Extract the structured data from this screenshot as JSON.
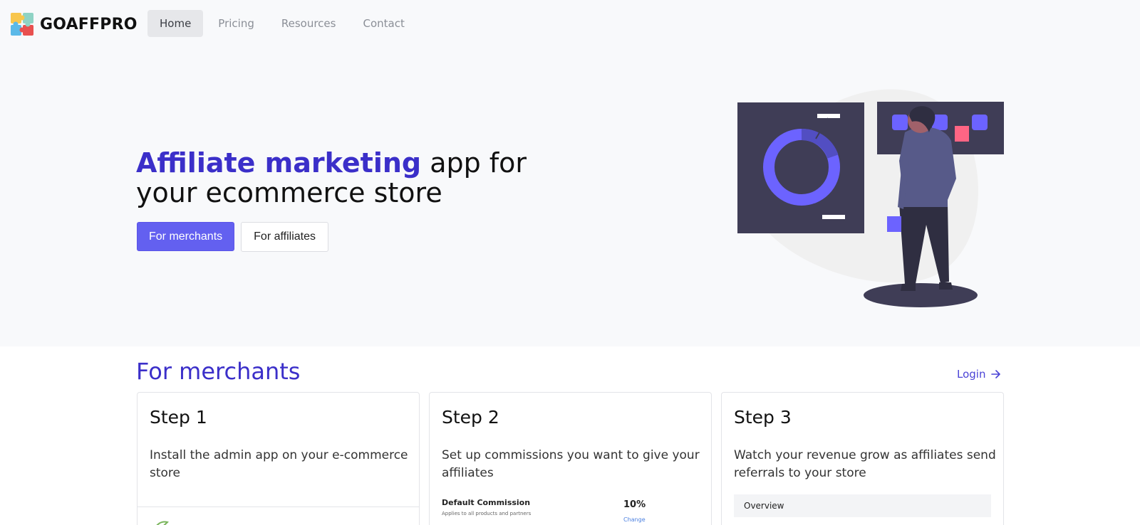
{
  "brand": {
    "name": "GOAFFPRO"
  },
  "nav": {
    "items": [
      {
        "label": "Home",
        "active": true
      },
      {
        "label": "Pricing",
        "active": false
      },
      {
        "label": "Resources",
        "active": false
      },
      {
        "label": "Contact",
        "active": false
      }
    ]
  },
  "hero": {
    "title_accent": "Affiliate marketing",
    "title_rest": " app for your ecommerce store",
    "primary_button": "For merchants",
    "secondary_button": "For affiliates"
  },
  "merchants": {
    "title": "For merchants",
    "login_label": "Login",
    "login_icon": "arrow-right-icon",
    "steps": [
      {
        "title": "Step 1",
        "text": "Install the admin app on your e-commerce store"
      },
      {
        "title": "Step 2",
        "text": "Set up commissions you want to give your affiliates"
      },
      {
        "title": "Step 3",
        "text": "Watch your revenue grow as affiliates send referrals to your store"
      }
    ],
    "commission_preview": {
      "label": "Default Commission",
      "sub": "Applies to all products and partners",
      "value": "10%",
      "change": "Change"
    },
    "overview_preview": {
      "label": "Overview"
    }
  },
  "colors": {
    "accent": "#3b2fc9",
    "button_primary": "#6360f0",
    "hero_bg": "#f8f9fb"
  }
}
